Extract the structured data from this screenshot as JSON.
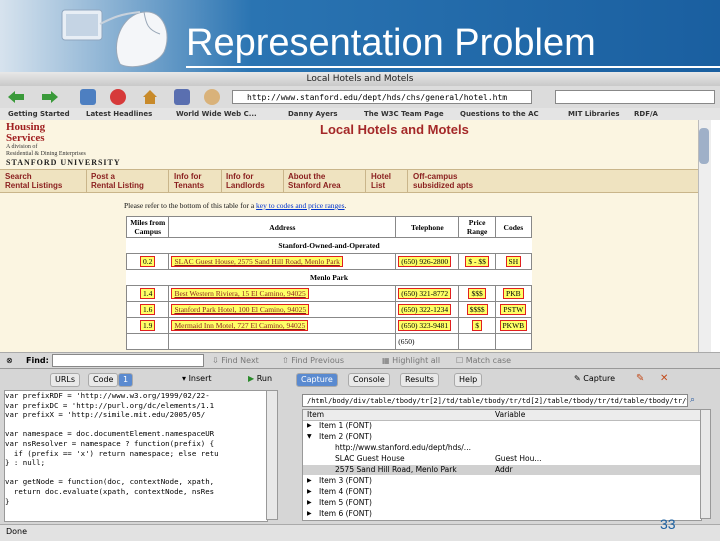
{
  "slide": {
    "title": "Representation Problem",
    "number": "33"
  },
  "browser": {
    "window_title": "Local Hotels and Motels",
    "url": "http://www.stanford.edu/dept/hds/chs/general/hotel.htm",
    "bookmarks": [
      "Getting Started",
      "Latest Headlines",
      "World Wide Web C...",
      "Danny Ayers",
      "The W3C Team Page",
      "Questions to the AC",
      "MIT Libraries",
      "RDF/A"
    ],
    "status": "Done"
  },
  "page": {
    "logo": {
      "name_line1": "Housing",
      "name_line2": "Services",
      "division": "A division of\nResidential & Dining Enterprises",
      "university": "STANFORD UNIVERSITY"
    },
    "heading": "Local Hotels and Motels",
    "nav": [
      {
        "line1": "Search",
        "line2": "Rental Listings"
      },
      {
        "line1": "Post a",
        "line2": "Rental Listing"
      },
      {
        "line1": "Info for",
        "line2": "Tenants"
      },
      {
        "line1": "Info for",
        "line2": "Landlords"
      },
      {
        "line1": "About the",
        "line2": "Stanford Area"
      },
      {
        "line1": "Hotel",
        "line2": "List"
      },
      {
        "line1": "Off-campus",
        "line2": "subsidized apts"
      }
    ],
    "notice_prefix": "Please refer to the bottom of this table for a ",
    "notice_link": "key to codes and price ranges",
    "notice_suffix": ".",
    "table": {
      "headers": [
        "Miles from Campus",
        "Address",
        "Telephone",
        "Price Range",
        "Codes"
      ],
      "sections": [
        {
          "name": "Stanford-Owned-and-Operated",
          "rows": [
            {
              "miles": "0.2",
              "address": "SLAC Guest House, 2575 Sand Hill Road, Menlo Park",
              "phone": "(650) 926-2800",
              "price": "$ - $$",
              "codes": "SH"
            }
          ]
        },
        {
          "name": "Menlo Park",
          "rows": [
            {
              "miles": "1.4",
              "address": "Best Western Riviera, 15 El Camino, 94025",
              "phone": "(650) 321-8772",
              "price": "$$$",
              "codes": "PKB"
            },
            {
              "miles": "1.6",
              "address": "Stanford Park Hotel, 100 El Camino, 94025",
              "phone": "(650) 322-1234",
              "price": "$$$$",
              "codes": "PSTW"
            },
            {
              "miles": "1.9",
              "address": "Mermaid Inn Motel, 727 El Camino, 94025",
              "phone": "(650) 323-9481",
              "price": "$",
              "codes": "PKWB"
            }
          ]
        }
      ],
      "partial_row_phone": "(650)"
    }
  },
  "findbar": {
    "label": "Find:",
    "next": "Find Next",
    "previous": "Find Previous",
    "highlight": "Highlight all",
    "match_case": "Match case"
  },
  "panel": {
    "left_tabs": [
      "URLs",
      "Code",
      "1"
    ],
    "insert_label": "Insert",
    "run_label": "Run",
    "code_lines": [
      "var prefixRDF = 'http://www.w3.org/1999/02/22-",
      "var prefixDC = 'http://purl.org/dc/elements/1.1",
      "var prefixX = 'http://simile.mit.edu/2005/05/",
      "",
      "var namespace = doc.documentElement.namespaceUR",
      "var nsResolver = namespace ? function(prefix) {",
      "  if (prefix == 'x') return namespace; else retu",
      "} : null;",
      "",
      "var getNode = function(doc, contextNode, xpath,",
      "  return doc.evaluate(xpath, contextNode, nsRes",
      "}"
    ],
    "right_tabs": [
      "Capture",
      "Console",
      "Results",
      "Help"
    ],
    "capture_label": "Capture",
    "xpath": "/html/body/div/table/tbody/tr[2]/td/table/tbody/tr/td[2]/table/tbody/tr/td/table/tbody/tr/td/",
    "columns": [
      "Item",
      "Variable"
    ],
    "items": [
      {
        "label": "Item 1 (FONT)",
        "variable": "",
        "expander": "▶"
      },
      {
        "label": "Item 2 (FONT)",
        "variable": "",
        "expander": "▼"
      },
      {
        "label": "http://www.stanford.edu/dept/hds/...",
        "variable": "",
        "expander": ""
      },
      {
        "label": "SLAC Guest House",
        "variable": "Guest Hou...",
        "expander": ""
      },
      {
        "label": "2575 Sand Hill Road, Menlo Park",
        "variable": "Addr",
        "expander": ""
      },
      {
        "label": "Item 3 (FONT)",
        "variable": "",
        "expander": "▶"
      },
      {
        "label": "Item 4 (FONT)",
        "variable": "",
        "expander": "▶"
      },
      {
        "label": "Item 5 (FONT)",
        "variable": "",
        "expander": "▶"
      },
      {
        "label": "Item 6 (FONT)",
        "variable": "",
        "expander": "▶"
      }
    ]
  },
  "colors": {
    "header_blue": "#1a5fa0",
    "page_bg": "#fbf5e1",
    "heading_red": "#a42828",
    "highlight": "#ffff66"
  }
}
